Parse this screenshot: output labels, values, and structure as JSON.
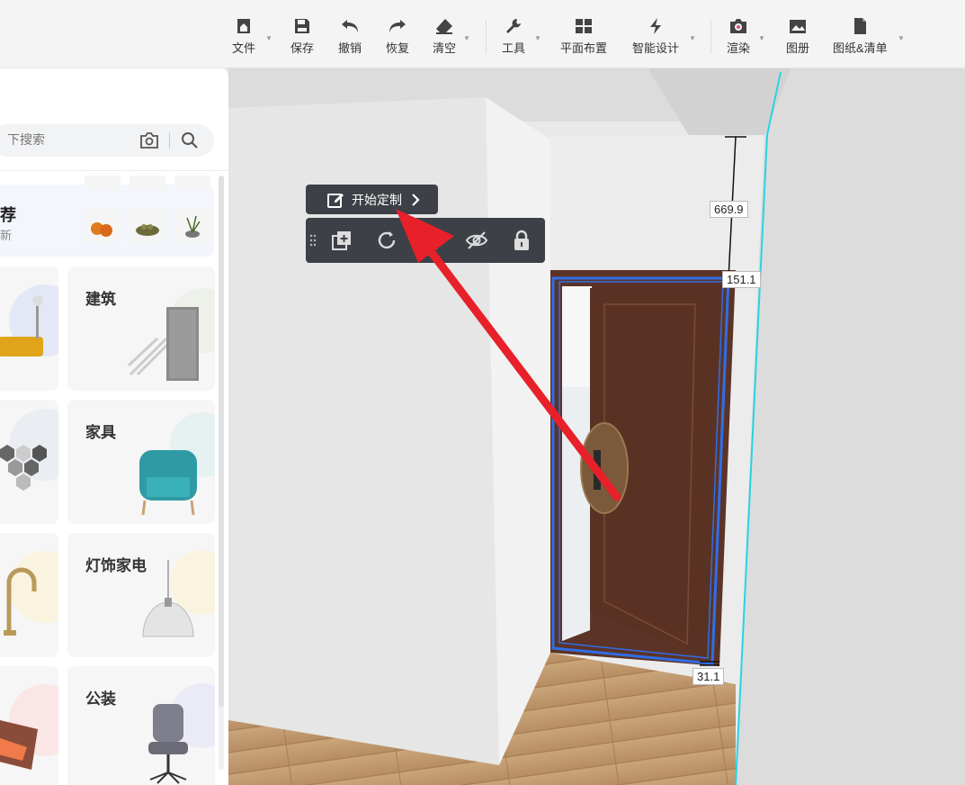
{
  "toolbar": {
    "items": [
      {
        "label": "文件",
        "icon": "home-file-icon"
      },
      {
        "label": "保存",
        "icon": "save-icon"
      },
      {
        "label": "撤销",
        "icon": "undo-icon"
      },
      {
        "label": "恢复",
        "icon": "redo-icon"
      },
      {
        "label": "清空",
        "icon": "eraser-icon"
      },
      {
        "label": "工具",
        "icon": "wrench-icon"
      },
      {
        "label": "平面布置",
        "icon": "floor-plan-icon"
      },
      {
        "label": "智能设计",
        "icon": "smart-design-icon"
      },
      {
        "label": "渲染",
        "icon": "camera-icon"
      },
      {
        "label": "图册",
        "icon": "album-icon"
      },
      {
        "label": "图纸&清单",
        "icon": "document-icon"
      }
    ]
  },
  "sidebar": {
    "search_placeholder": "下搜索",
    "recommend": {
      "title": "荐",
      "subtitle": "新"
    },
    "categories": [
      {
        "label": "建筑"
      },
      {
        "label": "家具"
      },
      {
        "label": "灯饰家电"
      },
      {
        "label": "公装"
      }
    ]
  },
  "floating": {
    "customize_label": "开始定制",
    "object_tools": [
      "drag-handle-icon",
      "copy-icon",
      "rotate-icon",
      "delete-icon",
      "hide-icon",
      "lock-icon"
    ]
  },
  "dimensions": {
    "height_top": "669.9",
    "width_door": "151.1",
    "bottom": "31.1"
  },
  "colors": {
    "door": "#5c3427",
    "selection": "#2f6ee8",
    "wall_edge": "#27d3e6",
    "arrow": "#e8202a",
    "floating_bg": "#3d4046"
  }
}
